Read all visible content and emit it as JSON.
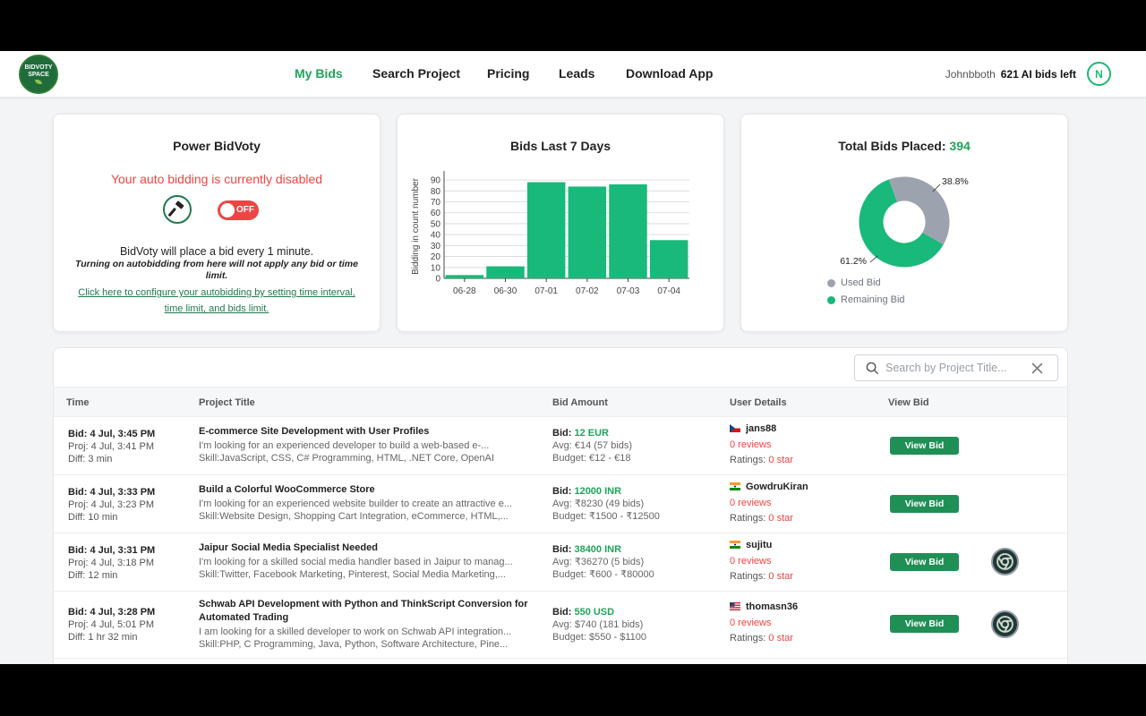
{
  "header": {
    "logo_text_top": "BIDVOTY",
    "logo_text_bottom": "SPACE",
    "nav": [
      {
        "label": "My Bids",
        "active": true
      },
      {
        "label": "Search Project",
        "active": false
      },
      {
        "label": "Pricing",
        "active": false
      },
      {
        "label": "Leads",
        "active": false
      },
      {
        "label": "Download App",
        "active": false
      }
    ],
    "username": "Johnbboth",
    "bids_left": "621 AI bids left",
    "avatar_initial": "N"
  },
  "power": {
    "title": "Power BidVoty",
    "status": "Your auto bidding is currently  disabled",
    "toggle_label": "OFF",
    "description": "BidVoty will place a bid every 1 minute.",
    "note": "Turning on autobidding from here will not apply any bid or time limit.",
    "config_link": "Click here to configure your autobidding by setting time interval, time limit, and bids limit."
  },
  "chart_title": "Bids Last 7 Days",
  "chart_data": {
    "type": "bar",
    "title": "Bids Last 7 Days",
    "categories": [
      "06-28",
      "06-30",
      "07-01",
      "07-02",
      "07-03",
      "07-04"
    ],
    "values": [
      3,
      11,
      88,
      84,
      86,
      35
    ],
    "ylabel": "Bidding in count number",
    "xlabel": "",
    "ylim": [
      0,
      95
    ],
    "yticks": [
      0,
      10,
      20,
      30,
      40,
      50,
      60,
      70,
      80,
      90
    ],
    "grid": true,
    "color": "#18b97a"
  },
  "total": {
    "title_prefix": "Total Bids Placed: ",
    "count": "394",
    "used_pct": 38.8,
    "remaining_pct": 61.2,
    "used_label": "38.8%",
    "remaining_label": "61.2%",
    "legend_used": "Used Bid",
    "legend_remaining": "Remaining Bid",
    "color_used": "#9ca3af",
    "color_remaining": "#18b97a"
  },
  "search": {
    "placeholder": "Search by Project Title..."
  },
  "table": {
    "headers": {
      "time": "Time",
      "project": "Project Title",
      "bid": "Bid Amount",
      "user": "User Details",
      "view": "View Bid"
    },
    "rows": [
      {
        "bid_time": "Bid: 4 Jul, 3:45 PM",
        "proj_time": "Proj: 4 Jul, 3:41 PM",
        "diff": "Diff: 3 min",
        "title": "E-commerce Site Development with User Profiles",
        "desc": "I'm looking for an experienced developer to build a web-based e-...",
        "skills": "Skill:JavaScript, CSS, C# Programming, HTML, .NET Core, OpenAI",
        "bid_label": "Bid: ",
        "bid_amount": "12 EUR",
        "avg": "Avg: €14  (57 bids)",
        "budget": "Budget: €12 - €18",
        "flag": "cz",
        "user": "jans88",
        "reviews": "0 reviews",
        "ratings_label": "Ratings: ",
        "ratings": "0 star",
        "view_label": "View Bid",
        "has_browser": false
      },
      {
        "bid_time": "Bid: 4 Jul, 3:33 PM",
        "proj_time": "Proj: 4 Jul, 3:23 PM",
        "diff": "Diff: 10 min",
        "title": "Build a Colorful WooCommerce Store",
        "desc": "I'm looking for an experienced website builder to create an attractive e...",
        "skills": "Skill:Website Design, Shopping Cart Integration, eCommerce, HTML,...",
        "bid_label": "Bid: ",
        "bid_amount": "12000 INR",
        "avg": "Avg: ₹8230  (49 bids)",
        "budget": "Budget: ₹1500 - ₹12500",
        "flag": "in",
        "user": "GowdruKiran",
        "reviews": "0 reviews",
        "ratings_label": "Ratings: ",
        "ratings": "0 star",
        "view_label": "View Bid",
        "has_browser": false
      },
      {
        "bid_time": "Bid: 4 Jul, 3:31 PM",
        "proj_time": "Proj: 4 Jul, 3:18 PM",
        "diff": "Diff: 12 min",
        "title": "Jaipur Social Media Specialist Needed",
        "desc": "I'm looking for a skilled social media handler based in Jaipur to manag...",
        "skills": "Skill:Twitter, Facebook Marketing, Pinterest, Social Media Marketing,...",
        "bid_label": "Bid: ",
        "bid_amount": "38400 INR",
        "avg": "Avg: ₹36270  (5 bids)",
        "budget": "Budget: ₹600 - ₹80000",
        "flag": "in",
        "user": "sujitu",
        "reviews": "0 reviews",
        "ratings_label": "Ratings: ",
        "ratings": "0 star",
        "view_label": "View Bid",
        "has_browser": true
      },
      {
        "bid_time": "Bid: 4 Jul, 3:28 PM",
        "proj_time": "Proj: 4 Jul, 5:01 PM",
        "diff": "Diff: 1 hr 32 min",
        "title": "Schwab API Development with Python and ThinkScript Conversion for Automated Trading",
        "desc": "I am looking for a skilled developer to work on Schwab API integration...",
        "skills": "Skill:PHP, C Programming, Java, Python, Software Architecture, Pine...",
        "bid_label": "Bid: ",
        "bid_amount": "550 USD",
        "avg": "Avg: $740  (181 bids)",
        "budget": "Budget: $550 - $1100",
        "flag": "us",
        "user": "thomasn36",
        "reviews": "0 reviews",
        "ratings_label": "Ratings: ",
        "ratings": "0 star",
        "view_label": "View Bid",
        "has_browser": true
      }
    ]
  }
}
